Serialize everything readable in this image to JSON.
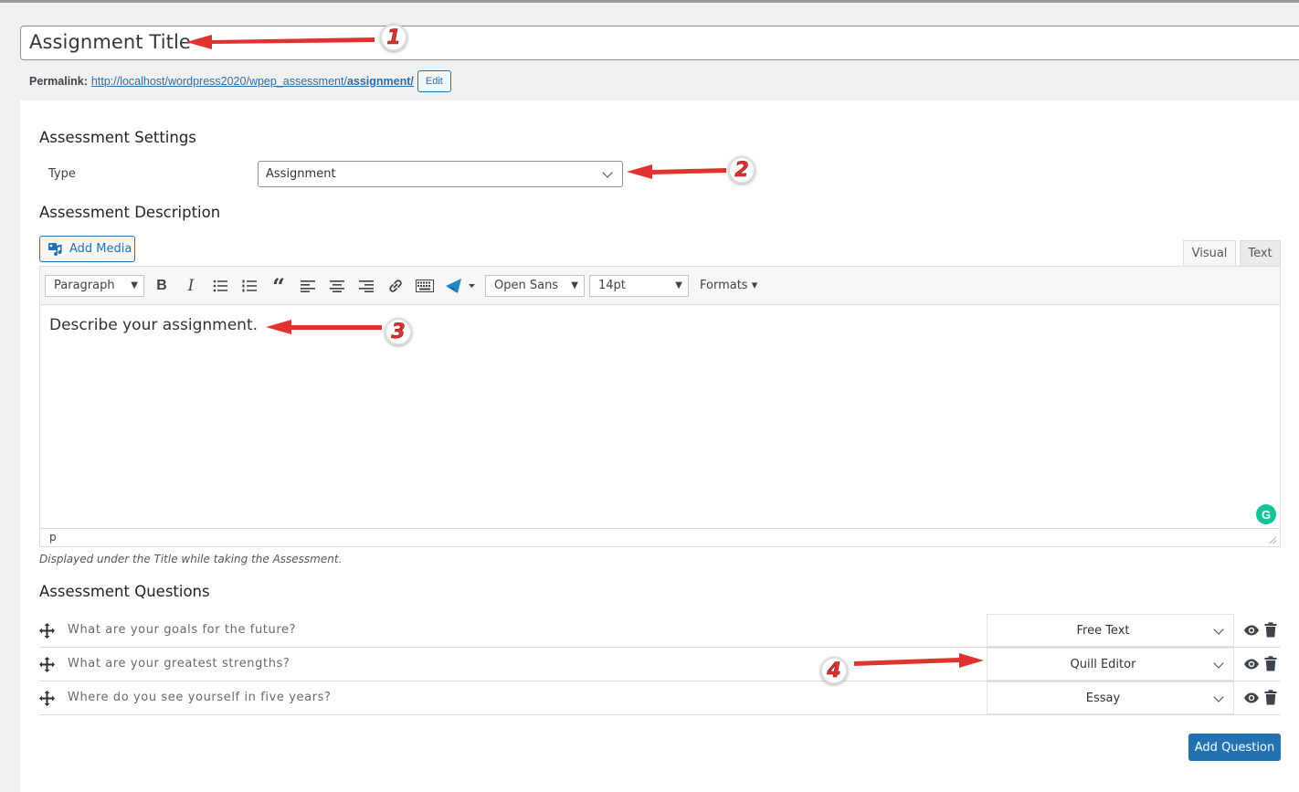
{
  "post": {
    "title": "Assignment Title",
    "permalink_label": "Permalink:",
    "permalink_base": "http://localhost/wordpress2020/wpep_assessment/",
    "permalink_slug": "assignment/",
    "edit_label": "Edit"
  },
  "settings": {
    "heading": "Assessment Settings",
    "type_label": "Type",
    "type_value": "Assignment"
  },
  "description": {
    "heading": "Assessment Description",
    "add_media_label": "Add Media",
    "tab_visual": "Visual",
    "tab_text": "Text",
    "toolbar": {
      "paragraph": "Paragraph",
      "font_family": "Open Sans",
      "font_size": "14pt",
      "formats": "Formats ▾"
    },
    "content": "Describe your assignment.",
    "status_path": "p",
    "hint": "Displayed under the Title while taking the Assessment."
  },
  "questions": {
    "heading": "Assessment Questions",
    "items": [
      {
        "text": "What are your goals for the future?",
        "type": "Free Text"
      },
      {
        "text": "What are your greatest strengths?",
        "type": "Quill Editor"
      },
      {
        "text": "Where do you see yourself in five years?",
        "type": "Essay"
      }
    ],
    "add_label": "Add Question"
  },
  "annotations": [
    "1",
    "2",
    "3",
    "4"
  ],
  "colors": {
    "accent": "#2271b1",
    "annotation": "#e0322f",
    "grammarly": "#15c39a"
  }
}
